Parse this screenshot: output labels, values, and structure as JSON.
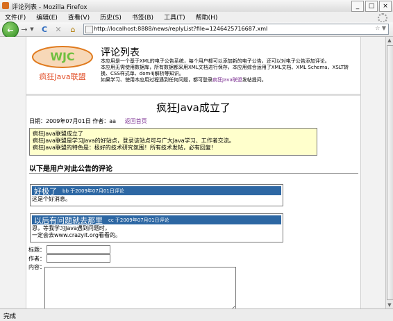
{
  "window": {
    "title": "评论列表 - Mozilla Firefox",
    "controls": [
      "_",
      "□",
      "×"
    ]
  },
  "menu": [
    "文件(F)",
    "编辑(E)",
    "查看(V)",
    "历史(S)",
    "书签(B)",
    "工具(T)",
    "帮助(H)"
  ],
  "nav": {
    "url": "http://localhost:8888/news/replyList?file=1246425716687.xml",
    "icons": [
      "back-icon",
      "forward-icon",
      "dropdown-icon",
      "reload-icon",
      "stop-icon",
      "home-icon"
    ]
  },
  "header": {
    "logo_text": "WJC",
    "logo_sub": "疯狂Java联盟",
    "title": "评论列表",
    "desc1": "本应用是一个基于XML的电子公告系统，每个用户都可以添加新的电子公告，还可以对电子公告添加评论。",
    "desc2": "本应用无需使用数据库，所有数据都采用XML文档进行保存，本应用综合运用了XML文档、XML Schema、XSLT转换、CSS样式单、dom4j解析等知识。",
    "desc3_prefix": "如果学习、使用本应用过程遇到任何问题，都可登录",
    "desc3_link": "疯狂Java联盟",
    "desc3_suffix": "发帖提问。"
  },
  "article": {
    "title": "疯狂Java成立了",
    "date": "日期：2009年07月01日",
    "author": "作者：aa",
    "back": "返回首页",
    "body_lines": [
      "疯狂Java联盟成立了",
      "疯狂Java联盟是学习Java的好站点，登录该站点可与广大Java学习、工作者交流。",
      "疯狂Java联盟的特色是：极好的技术研究氛围！所有技术发帖，必有回复！"
    ]
  },
  "comments_section_title": "以下是用户对此公告的评论",
  "comments": [
    {
      "title": "好极了",
      "meta": "bb 于2009年07月01日评论",
      "lines": [
        "这是个好消息。"
      ]
    },
    {
      "title": "以后有问题就去那里",
      "meta": "cc 于2009年07月01日评论",
      "lines": [
        "恩，等我学习Java遇到问题时，",
        "一定会去www.crazyit.org看看的。"
      ]
    }
  ],
  "form": {
    "title_label": "标题：",
    "author_label": "作者：",
    "content_label": "内容："
  },
  "status": "完成"
}
